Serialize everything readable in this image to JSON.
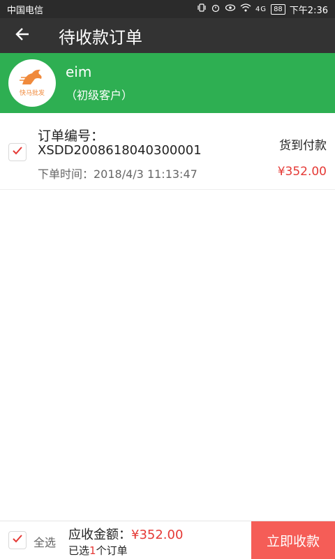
{
  "statusbar": {
    "carrier": "中国电信",
    "battery": "88",
    "signal": "4G",
    "time": "下午2:36"
  },
  "appbar": {
    "title": "待收款订单"
  },
  "customer": {
    "logo_text": "快马批发",
    "name": "eim",
    "level": "（初级客户）"
  },
  "order": {
    "number_label": "订单编号：",
    "number": "XSDD2008618040300001",
    "payment_method": "货到付款",
    "time": "下单时间：2018/4/3 11:13:47",
    "amount": "¥352.00"
  },
  "bottombar": {
    "select_all": "全选",
    "total_label": "应收金额：",
    "total_amount": "¥352.00",
    "selected_prefix": "已选",
    "selected_count": "1",
    "selected_suffix": "个订单",
    "collect_button": "立即收款"
  },
  "colors": {
    "customer_bg": "#2eaf52",
    "accent_red": "#e53935",
    "button_red": "#f55d57",
    "appbar_bg": "#333333"
  }
}
